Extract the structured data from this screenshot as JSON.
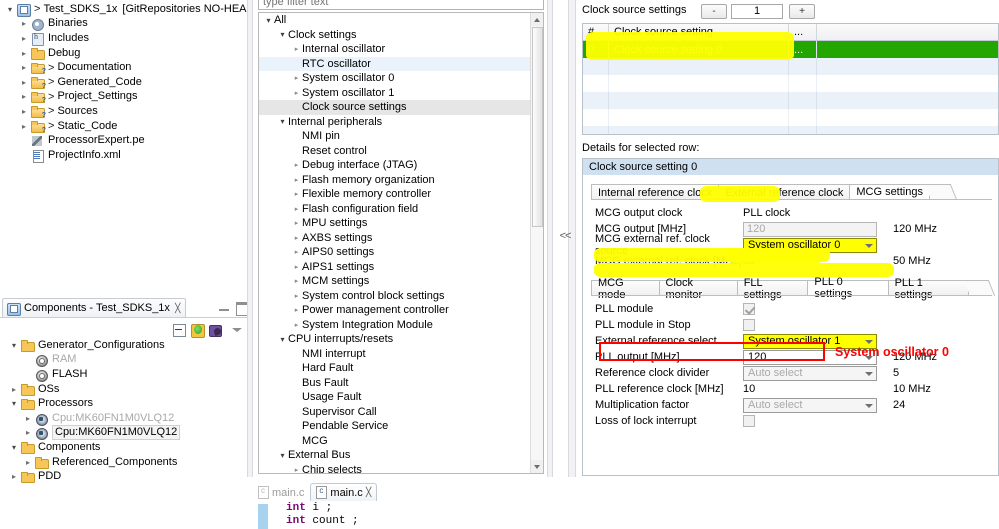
{
  "project_explorer": {
    "nodes": [
      {
        "label": "Test_SDKS_1x",
        "suffix": "[GitRepositories NO-HEAD]",
        "icon": "project-icon",
        "indent": 0,
        "arrow": "open",
        "gt": true
      },
      {
        "label": "Binaries",
        "icon": "binaries-icon",
        "indent": 1,
        "arrow": "closed",
        "gt": false
      },
      {
        "label": "Includes",
        "icon": "includes-icon",
        "indent": 1,
        "arrow": "closed",
        "gt": false
      },
      {
        "label": "Debug",
        "icon": "folder-icon",
        "indent": 1,
        "arrow": "closed",
        "gt": false
      },
      {
        "label": "Documentation",
        "icon": "folder-q-icon",
        "indent": 1,
        "arrow": "closed",
        "gt": true
      },
      {
        "label": "Generated_Code",
        "icon": "folder-q-icon",
        "indent": 1,
        "arrow": "closed",
        "gt": true
      },
      {
        "label": "Project_Settings",
        "icon": "folder-q-icon",
        "indent": 1,
        "arrow": "closed",
        "gt": true
      },
      {
        "label": "Sources",
        "icon": "folder-q-icon",
        "indent": 1,
        "arrow": "closed",
        "gt": true
      },
      {
        "label": "Static_Code",
        "icon": "folder-q-icon",
        "indent": 1,
        "arrow": "closed",
        "gt": true
      },
      {
        "label": "ProcessorExpert.pe",
        "icon": "pe-file-icon",
        "indent": 1,
        "arrow": "none",
        "gt": false
      },
      {
        "label": "ProjectInfo.xml",
        "icon": "xml-file-icon",
        "indent": 1,
        "arrow": "none",
        "gt": false
      }
    ]
  },
  "components_view": {
    "tab_title": "Components - Test_SDKS_1x",
    "close_glyph": "╳",
    "toolbar": {
      "minimize": "minimize-icon",
      "maximize": "maximize-icon",
      "collapse_all": "collapse-all-icon",
      "refresh": "refresh-icon",
      "component": "component-icon",
      "view_menu": "view-menu-icon"
    },
    "nodes": [
      {
        "label": "Generator_Configurations",
        "icon": "folder-icon",
        "indent": 0,
        "arrow": "open",
        "dim": false,
        "boxed": false
      },
      {
        "label": "RAM",
        "icon": "config-icon",
        "indent": 1,
        "arrow": "none",
        "dim": true,
        "boxed": false
      },
      {
        "label": "FLASH",
        "icon": "config-icon",
        "indent": 1,
        "arrow": "none",
        "dim": false,
        "boxed": false
      },
      {
        "label": "OSs",
        "icon": "folder-icon",
        "indent": 0,
        "arrow": "closed",
        "dim": false,
        "boxed": false
      },
      {
        "label": "Processors",
        "icon": "folder-icon",
        "indent": 0,
        "arrow": "open",
        "dim": false,
        "boxed": false
      },
      {
        "label": "Cpu:MK60FN1M0VLQ12",
        "icon": "cpu-icon",
        "indent": 1,
        "arrow": "closed",
        "dim": true,
        "boxed": false
      },
      {
        "label": "Cpu:MK60FN1M0VLQ12",
        "icon": "cpu-icon",
        "indent": 1,
        "arrow": "closed",
        "dim": false,
        "boxed": true
      },
      {
        "label": "Components",
        "icon": "folder-icon",
        "indent": 0,
        "arrow": "open",
        "dim": false,
        "boxed": false
      },
      {
        "label": "Referenced_Components",
        "icon": "folder-icon",
        "indent": 1,
        "arrow": "closed",
        "dim": false,
        "boxed": false
      },
      {
        "label": "PDD",
        "icon": "folder-icon",
        "indent": 0,
        "arrow": "closed",
        "dim": false,
        "boxed": false
      }
    ]
  },
  "filter": {
    "placeholder": "type filter text",
    "value": ""
  },
  "settings_tree": {
    "nodes": [
      {
        "label": "All",
        "indent": 0,
        "arrow": "open",
        "hl": "none"
      },
      {
        "label": "Clock settings",
        "indent": 1,
        "arrow": "open",
        "hl": "none"
      },
      {
        "label": "Internal oscillator",
        "indent": 2,
        "arrow": "closed",
        "hl": "none"
      },
      {
        "label": "RTC oscillator",
        "indent": 2,
        "arrow": "none",
        "hl": "a"
      },
      {
        "label": "System oscillator 0",
        "indent": 2,
        "arrow": "closed",
        "hl": "none"
      },
      {
        "label": "System oscillator 1",
        "indent": 2,
        "arrow": "closed",
        "hl": "none"
      },
      {
        "label": "Clock source settings",
        "indent": 2,
        "arrow": "none",
        "hl": "b"
      },
      {
        "label": "Internal peripherals",
        "indent": 1,
        "arrow": "open",
        "hl": "none"
      },
      {
        "label": "NMI pin",
        "indent": 2,
        "arrow": "none",
        "hl": "none"
      },
      {
        "label": "Reset control",
        "indent": 2,
        "arrow": "none",
        "hl": "none"
      },
      {
        "label": "Debug interface (JTAG)",
        "indent": 2,
        "arrow": "closed",
        "hl": "none"
      },
      {
        "label": "Flash memory organization",
        "indent": 2,
        "arrow": "closed",
        "hl": "none"
      },
      {
        "label": "Flexible memory controller",
        "indent": 2,
        "arrow": "closed",
        "hl": "none"
      },
      {
        "label": "Flash configuration field",
        "indent": 2,
        "arrow": "closed",
        "hl": "none"
      },
      {
        "label": "MPU settings",
        "indent": 2,
        "arrow": "closed",
        "hl": "none"
      },
      {
        "label": "AXBS settings",
        "indent": 2,
        "arrow": "closed",
        "hl": "none"
      },
      {
        "label": "AIPS0 settings",
        "indent": 2,
        "arrow": "closed",
        "hl": "none"
      },
      {
        "label": "AIPS1 settings",
        "indent": 2,
        "arrow": "closed",
        "hl": "none"
      },
      {
        "label": "MCM settings",
        "indent": 2,
        "arrow": "closed",
        "hl": "none"
      },
      {
        "label": "System control block settings",
        "indent": 2,
        "arrow": "closed",
        "hl": "none"
      },
      {
        "label": "Power management controller",
        "indent": 2,
        "arrow": "closed",
        "hl": "none"
      },
      {
        "label": "System Integration Module",
        "indent": 2,
        "arrow": "closed",
        "hl": "none"
      },
      {
        "label": "CPU interrupts/resets",
        "indent": 1,
        "arrow": "open",
        "hl": "none"
      },
      {
        "label": "NMI interrupt",
        "indent": 2,
        "arrow": "none",
        "hl": "none"
      },
      {
        "label": "Hard Fault",
        "indent": 2,
        "arrow": "none",
        "hl": "none"
      },
      {
        "label": "Bus Fault",
        "indent": 2,
        "arrow": "none",
        "hl": "none"
      },
      {
        "label": "Usage Fault",
        "indent": 2,
        "arrow": "none",
        "hl": "none"
      },
      {
        "label": "Supervisor Call",
        "indent": 2,
        "arrow": "none",
        "hl": "none"
      },
      {
        "label": "Pendable Service",
        "indent": 2,
        "arrow": "none",
        "hl": "none"
      },
      {
        "label": "MCG",
        "indent": 2,
        "arrow": "none",
        "hl": "none"
      },
      {
        "label": "External Bus",
        "indent": 1,
        "arrow": "open",
        "hl": "none"
      },
      {
        "label": "Chip selects",
        "indent": 2,
        "arrow": "closed",
        "hl": "none"
      }
    ]
  },
  "collapse_control": {
    "label": "<<"
  },
  "clock_source_panel": {
    "title": "Clock source settings",
    "stepper": {
      "minus_label": "-",
      "value": "1",
      "plus_label": "+"
    },
    "table": {
      "columns": [
        "#",
        "Clock source setting",
        "..."
      ],
      "rows": [
        {
          "index": "0",
          "name": "Clock source setting 0",
          "more": "...",
          "selected": true
        }
      ],
      "empty_row_count": 5
    },
    "details_label": "Details for selected row:",
    "group_title": "Clock source setting 0",
    "tabs": [
      {
        "label": "Internal reference clock",
        "active": false
      },
      {
        "label": "External reference clock",
        "active": false
      },
      {
        "label": "MCG settings",
        "active": true,
        "highlighted": true
      }
    ],
    "mcg_fields": [
      {
        "label": "MCG output clock",
        "value": "PLL clock",
        "right": "",
        "kind": "text"
      },
      {
        "label": "MCG output [MHz]",
        "value": "120",
        "right": "120 MHz",
        "kind": "input-disabled"
      },
      {
        "label": "MCG external ref. clock source",
        "value": "System oscillator 0",
        "right": "",
        "kind": "combo-yellow"
      },
      {
        "label": "MCG external ref. clock [MHz]",
        "value": "50",
        "right": "50 MHz",
        "kind": "text"
      }
    ],
    "inner_tabs": [
      {
        "label": "MCG mode",
        "active": false
      },
      {
        "label": "Clock monitor",
        "active": false
      },
      {
        "label": "FLL settings",
        "active": false
      },
      {
        "label": "PLL 0 settings",
        "active": true
      },
      {
        "label": "PLL 1 settings",
        "active": false
      }
    ],
    "pll_fields": [
      {
        "label": "PLL module",
        "value": "",
        "right": "",
        "kind": "checkbox-checked"
      },
      {
        "label": "PLL module in Stop",
        "value": "",
        "right": "",
        "kind": "checkbox"
      },
      {
        "label": "External reference select",
        "value": "System oscillator 1",
        "right": "",
        "kind": "combo-yellow-boxed"
      },
      {
        "label": "PLL output [MHz]",
        "value": "120",
        "right": "120 MHz",
        "kind": "combo-enabled"
      },
      {
        "label": "Reference clock divider",
        "value": "Auto select",
        "right": "5",
        "kind": "combo-disabled"
      },
      {
        "label": "PLL reference clock [MHz]",
        "value": "10",
        "right": "10 MHz",
        "kind": "text"
      },
      {
        "label": "Multiplication factor",
        "value": "Auto select",
        "right": "24",
        "kind": "combo-disabled"
      },
      {
        "label": "Loss of lock interrupt",
        "value": "",
        "right": "",
        "kind": "checkbox"
      }
    ],
    "annotation": {
      "text": "System oscillator 0",
      "color": "#ff0000"
    }
  },
  "editor": {
    "tabs": [
      {
        "label": "main.c",
        "active": false,
        "close": ""
      },
      {
        "label": "main.c",
        "active": true,
        "close": "╳"
      }
    ],
    "code_lines": [
      {
        "keyword": "int",
        "rest": " i ;"
      },
      {
        "keyword": "int",
        "rest": " count ;"
      }
    ]
  }
}
